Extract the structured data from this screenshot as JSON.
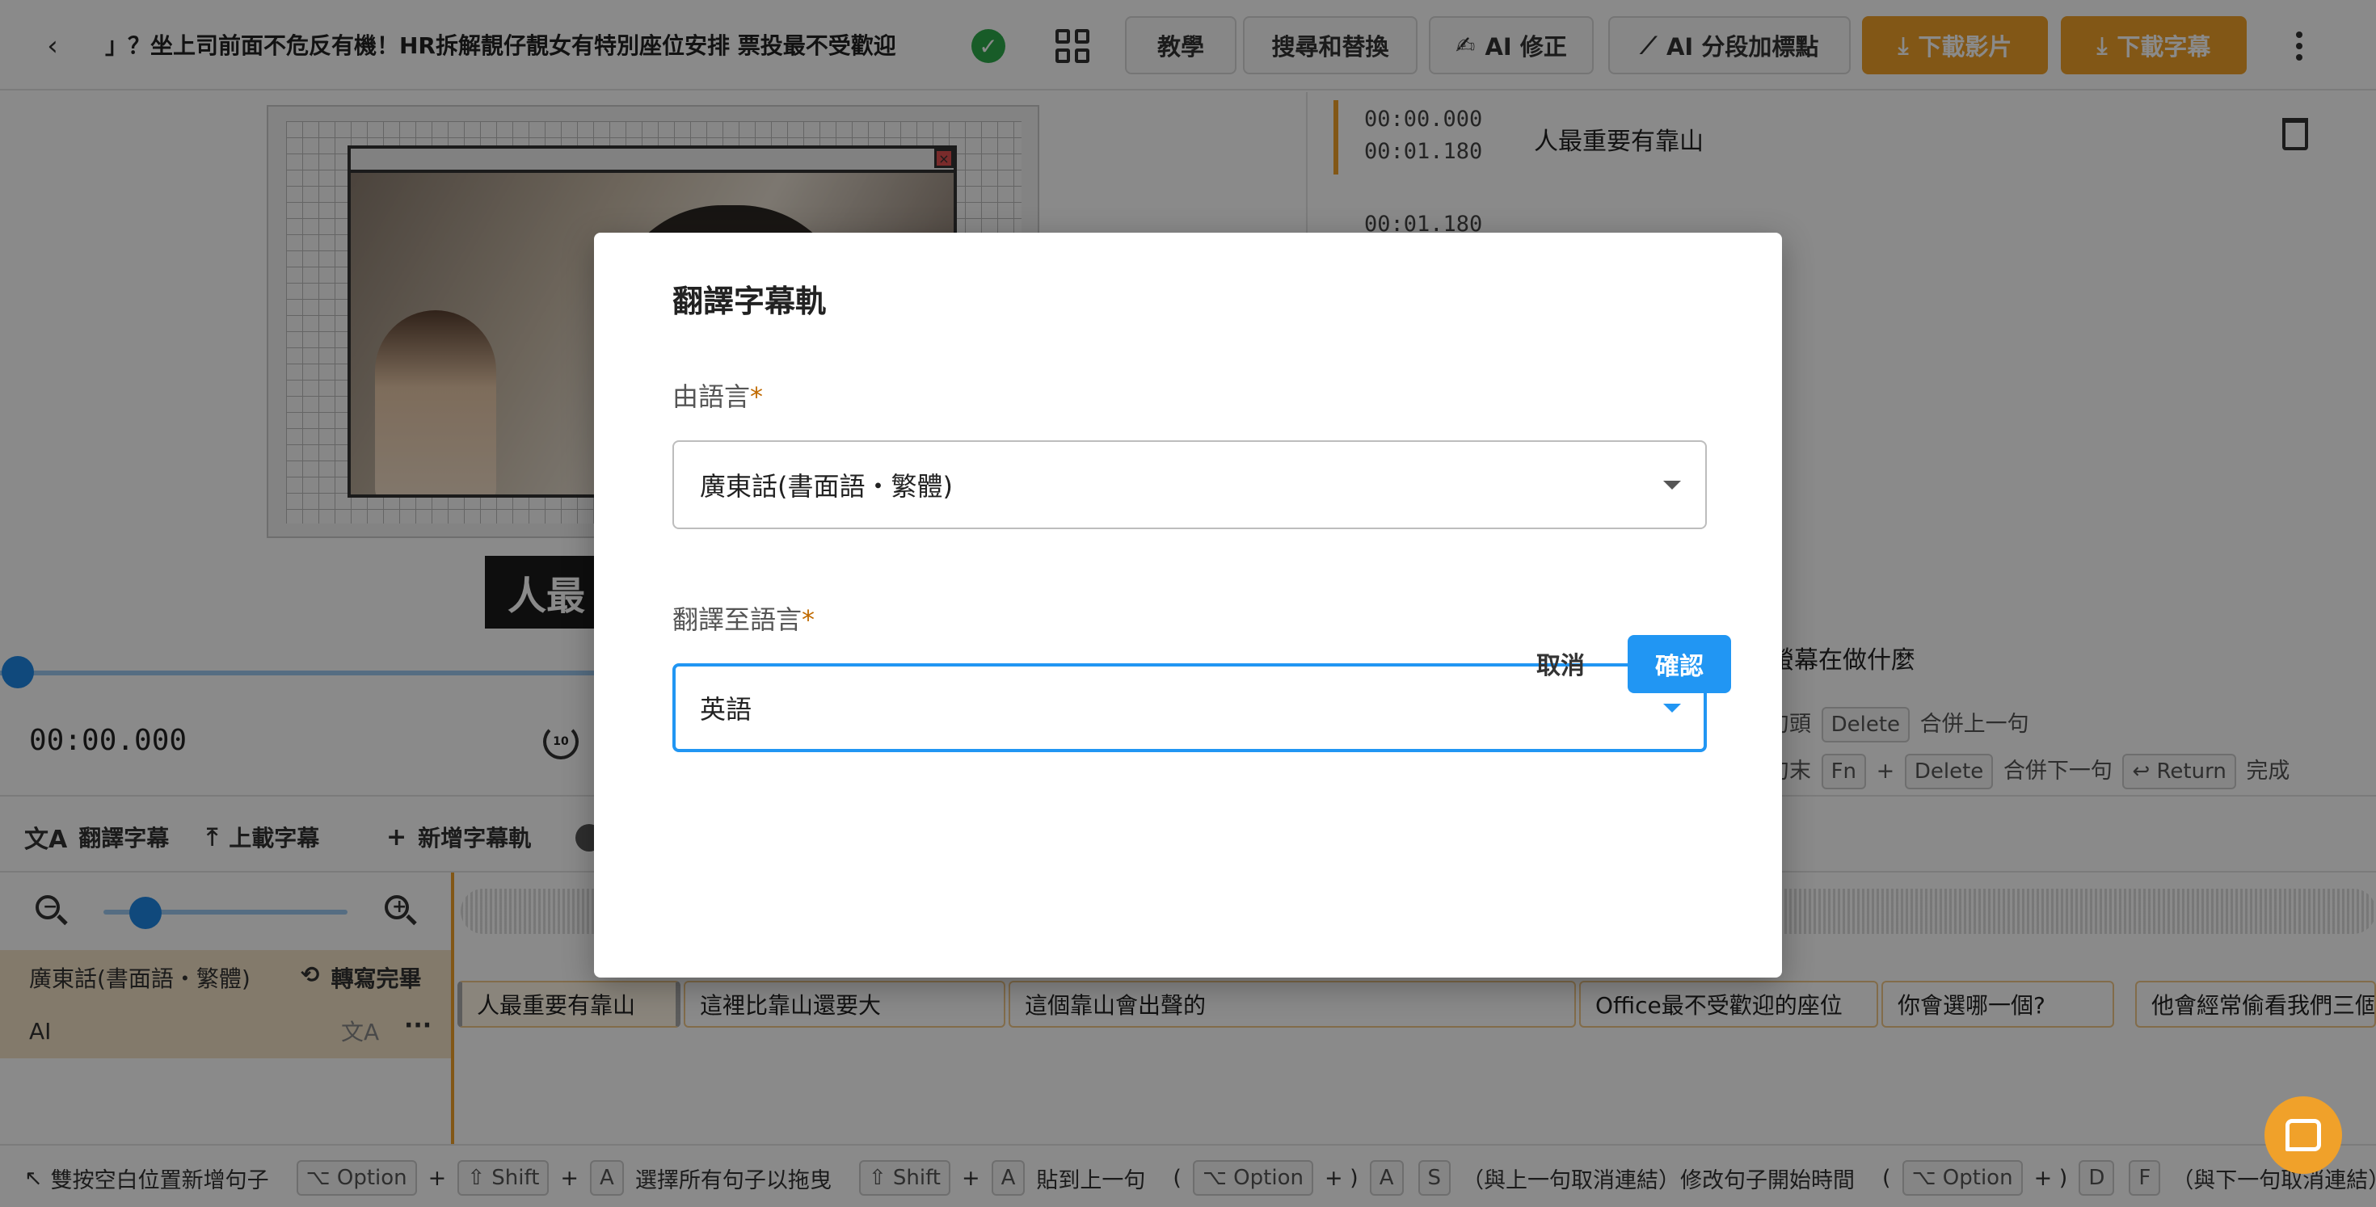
{
  "header": {
    "back_symbol": "‹",
    "title": "」？坐上司前面不危反有機！HR拆解靚仔靚女有特別座位安排 票投最不受歡迎",
    "buttons": {
      "tutorial": "教學",
      "search_replace": "搜尋和替換",
      "ai_fix": "AI 修正",
      "ai_segment": "AI 分段加標點",
      "download_video": "下載影片",
      "download_subtitle": "下載字幕"
    },
    "icons": {
      "check": "check-circle-icon",
      "grid": "grid-icon",
      "ai_fix": "pen-icon",
      "ai_segment": "magic-wand-icon",
      "download": "download-icon",
      "more": "more-vertical-icon"
    }
  },
  "video": {
    "overlay_text": "人最",
    "time": "00:00.000",
    "rewind_label": "10"
  },
  "subtitles": [
    {
      "start": "00:00.000",
      "end": "00:01.180",
      "text": "人最重要有靠山"
    },
    {
      "start": "00:01.180",
      "end": "",
      "text": ""
    }
  ],
  "right_panel": {
    "partial_line": "螢幕在做什麼",
    "hint_line1": {
      "pre": "於句頭",
      "key": "Delete",
      "post": "合併上一句"
    },
    "hint_line2": {
      "pre": "於句末",
      "key1": "Fn",
      "plus": "+",
      "key2": "Delete",
      "post": "合併下一句",
      "key3": "↩ Return",
      "post2": "完成"
    }
  },
  "toolbar": {
    "translate": "翻譯字幕",
    "upload": "上載字幕",
    "add_track": "新增字幕軌"
  },
  "timeline": {
    "track_language": "廣東話(書面語・繁體)",
    "transcribe_status": "轉寫完畢",
    "track_source": "AI",
    "segments": [
      "人最重要有靠山",
      "這裡比靠山還要大",
      "這個靠山會出聲的",
      "Office最不受歡迎的座位",
      "你會選哪一個?",
      "他會經常偷看我們三個"
    ]
  },
  "hint_bar": {
    "h1": "雙按空白位置新增句子",
    "k_option": "⌥ Option",
    "plus": "+",
    "k_shift": "⇧ Shift",
    "k_a": "A",
    "h2": "選擇所有句子以拖曳",
    "h3": "貼到上一句",
    "paren_open": "(",
    "paren_close": "+ )",
    "k_s": "S",
    "h4": "（與上一句取消連結）修改句子開始時間",
    "k_d": "D",
    "k_f": "F",
    "h5": "（與下一句取消連結）修"
  },
  "modal": {
    "title": "翻譯字幕軌",
    "from_label": "由語言",
    "required_mark": "*",
    "from_value": "廣東話(書面語・繁體)",
    "to_label": "翻譯至語言",
    "to_value": "英語",
    "cancel": "取消",
    "confirm": "確認"
  },
  "colors": {
    "accent_orange": "#f0a12a",
    "primary_blue": "#2196f3",
    "success_green": "#2eaa4a"
  }
}
